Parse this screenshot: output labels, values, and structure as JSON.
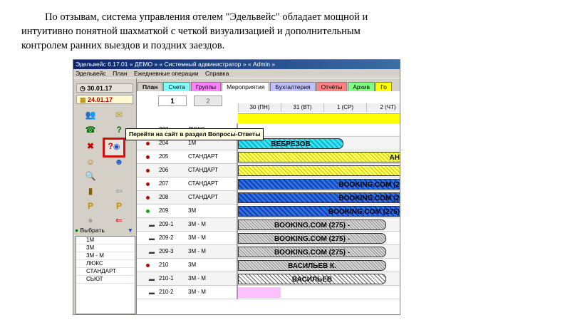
{
  "intro": {
    "line1": "По отзывам, система управления отелем \"Эдельвейс\" обладает мощной и",
    "line2": "интуитивно понятной шахматкой с четкой визуализацией и дополнительным",
    "line3": "контролем ранних выездов и поздних заездов."
  },
  "app": {
    "title": "Эдельвейс 6.17.01 « ДЕМО » « Системный администратор » « Admin »",
    "menu": [
      "Эдельвейс",
      "План",
      "Ежедневные операции",
      "Справка"
    ],
    "dates": [
      "30.01.17",
      "24.01.17"
    ],
    "tooltip": "Перейти на сайт в раздел  Вопросы-Ответы",
    "select_label": "Выбрать",
    "room_types": [
      "1М",
      "3М",
      "3М - М",
      "ЛЮКС",
      "СТАНДАРТ",
      "СЬЮТ"
    ],
    "tabs": [
      {
        "label": "План",
        "color": "#d4d0c8",
        "bold": true
      },
      {
        "label": "Счета",
        "color": "#80ffff"
      },
      {
        "label": "Группы",
        "color": "#ff80ff"
      },
      {
        "label": "Мероприятия",
        "color": "#ffffff"
      },
      {
        "label": "Бухгалтерия",
        "color": "#c0c0ff"
      },
      {
        "label": "Отчёты",
        "color": "#ff8080"
      },
      {
        "label": "Архив",
        "color": "#80ff80"
      },
      {
        "label": "Го",
        "color": "#ffff00"
      }
    ],
    "pages": [
      "1",
      "2"
    ],
    "columns": [
      "30 (ПН)",
      "31 (ВТ)",
      "1 (СР)",
      "2 (ЧТ)"
    ],
    "rows": [
      {
        "num": "203",
        "type": "ЛЮКС",
        "marker": "dot",
        "dot_color": "#c00000"
      },
      {
        "num": "204",
        "type": "1М",
        "marker": "dot",
        "dot_color": "#c00000",
        "bar": {
          "text": "ВЕБРЕЗОВ",
          "style": "cyan"
        }
      },
      {
        "num": "205",
        "type": "СТАНДАРТ",
        "marker": "dot",
        "dot_color": "#c00000",
        "bar": {
          "text": "АН",
          "style": "yellow"
        }
      },
      {
        "num": "206",
        "type": "СТАНДАРТ",
        "marker": "dot",
        "dot_color": "#c00000",
        "bar": {
          "text": "",
          "style": "yellow"
        }
      },
      {
        "num": "207",
        "type": "СТАНДАРТ",
        "marker": "dot",
        "dot_color": "#c00000",
        "bar": {
          "text": "BOOKING.COM (2",
          "style": "blue"
        }
      },
      {
        "num": "208",
        "type": "СТАНДАРТ",
        "marker": "dot",
        "dot_color": "#c00000",
        "bar": {
          "text": "BOOKING.COM (2",
          "style": "blue"
        }
      },
      {
        "num": "209",
        "type": "3М",
        "marker": "dot",
        "dot_color": "#00b000",
        "bar": {
          "text": "BOOKING.COM (275)",
          "style": "blue"
        }
      },
      {
        "num": "209-1",
        "type": "3М - М",
        "marker": "bed",
        "bar": {
          "text": "BOOKING.COM (275) -",
          "style": "grey"
        }
      },
      {
        "num": "209-2",
        "type": "3М - М",
        "marker": "bed",
        "bar": {
          "text": "BOOKING.COM (275) -",
          "style": "grey"
        }
      },
      {
        "num": "209-3",
        "type": "3М - М",
        "marker": "bed",
        "bar": {
          "text": "BOOKING.COM (275) -",
          "style": "grey"
        }
      },
      {
        "num": "210",
        "type": "3М",
        "marker": "dot",
        "dot_color": "#c00000",
        "bar": {
          "text": "ВАСИЛЬЕВ К.",
          "style": "grey"
        }
      },
      {
        "num": "210-1",
        "type": "3М - М",
        "marker": "bed",
        "bar": {
          "text": "ВАСИЛЬЕВ",
          "style": "white"
        }
      },
      {
        "num": "210-2",
        "type": "3М - М",
        "marker": "bed",
        "bar": {
          "text": "",
          "style": "pink"
        }
      }
    ]
  }
}
